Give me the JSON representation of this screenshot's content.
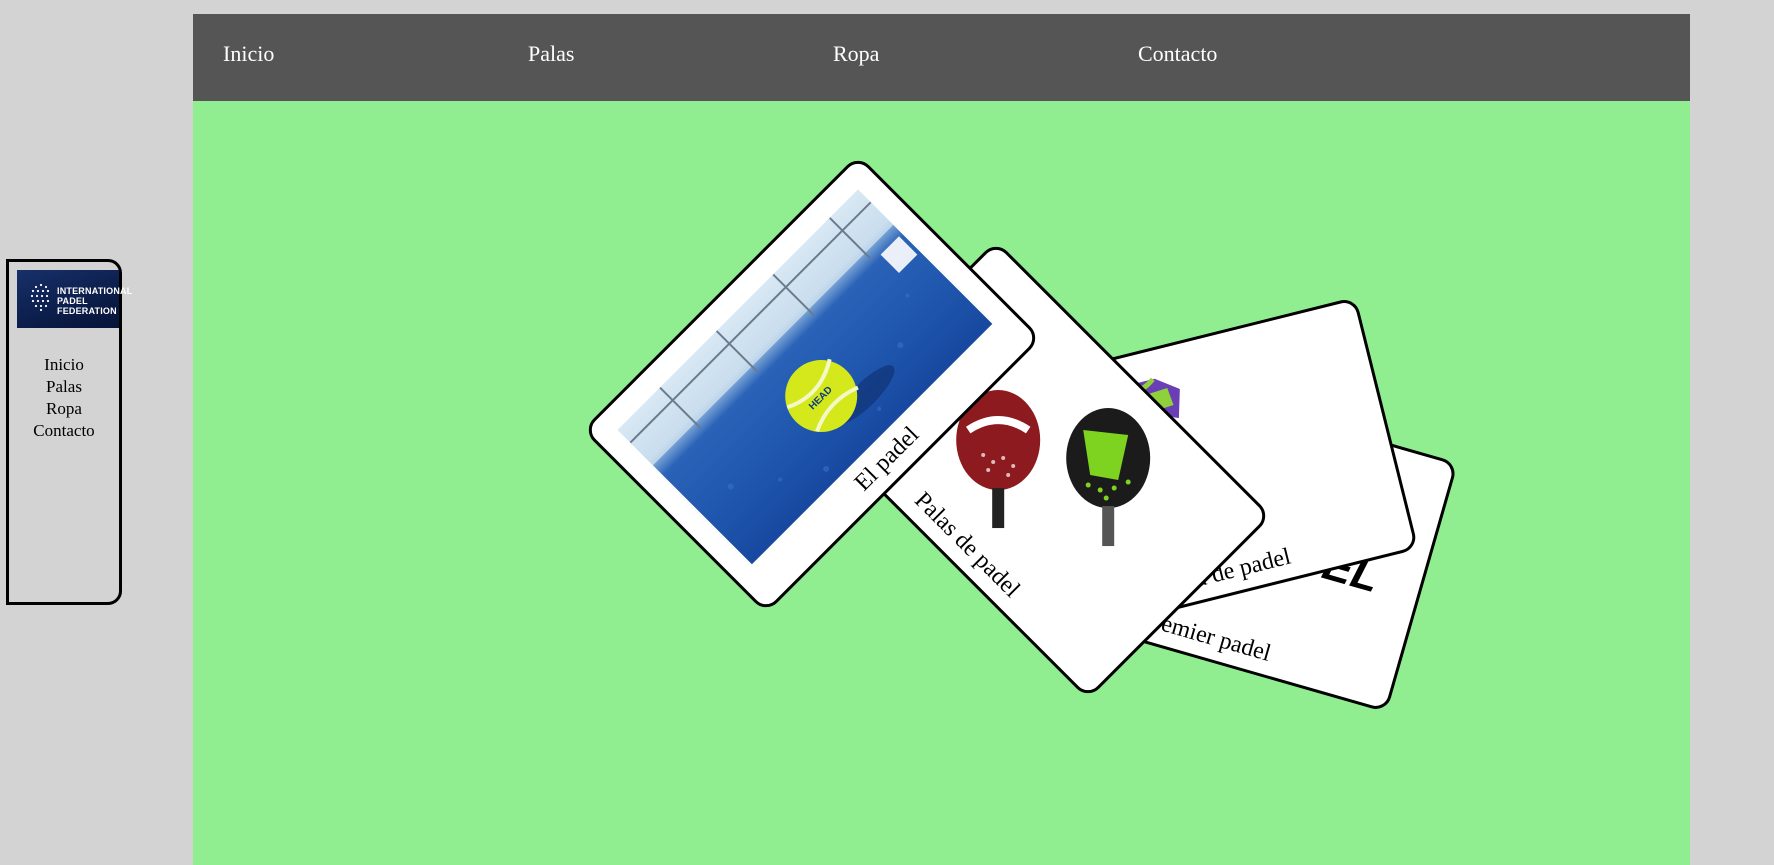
{
  "sidebar": {
    "logo": {
      "lines": [
        "INTERNATIONAL",
        "PADEL",
        "FEDERATION"
      ],
      "colors": {
        "bg": "#0a1b45",
        "text": "#ffffff"
      }
    },
    "nav": [
      {
        "label": "Inicio"
      },
      {
        "label": "Palas"
      },
      {
        "label": "Ropa"
      },
      {
        "label": "Contacto"
      }
    ]
  },
  "topnav": {
    "items": [
      {
        "label": "Inicio"
      },
      {
        "label": "Palas"
      },
      {
        "label": "Ropa"
      },
      {
        "label": "Contacto"
      }
    ]
  },
  "cards": [
    {
      "label": "Premier padel",
      "logo_text": "EL",
      "image": "premier-padel-logo"
    },
    {
      "label": "Ropa de padel",
      "image": "padel-clothing"
    },
    {
      "label": "Palas de padel",
      "image": "padel-rackets"
    },
    {
      "label": "El padel",
      "image": "padel-ball-on-court"
    }
  ],
  "colors": {
    "page_bg": "#d3d3d3",
    "main_bg": "#90ee90",
    "nav_bg": "#555555",
    "nav_text": "#ffffff"
  }
}
